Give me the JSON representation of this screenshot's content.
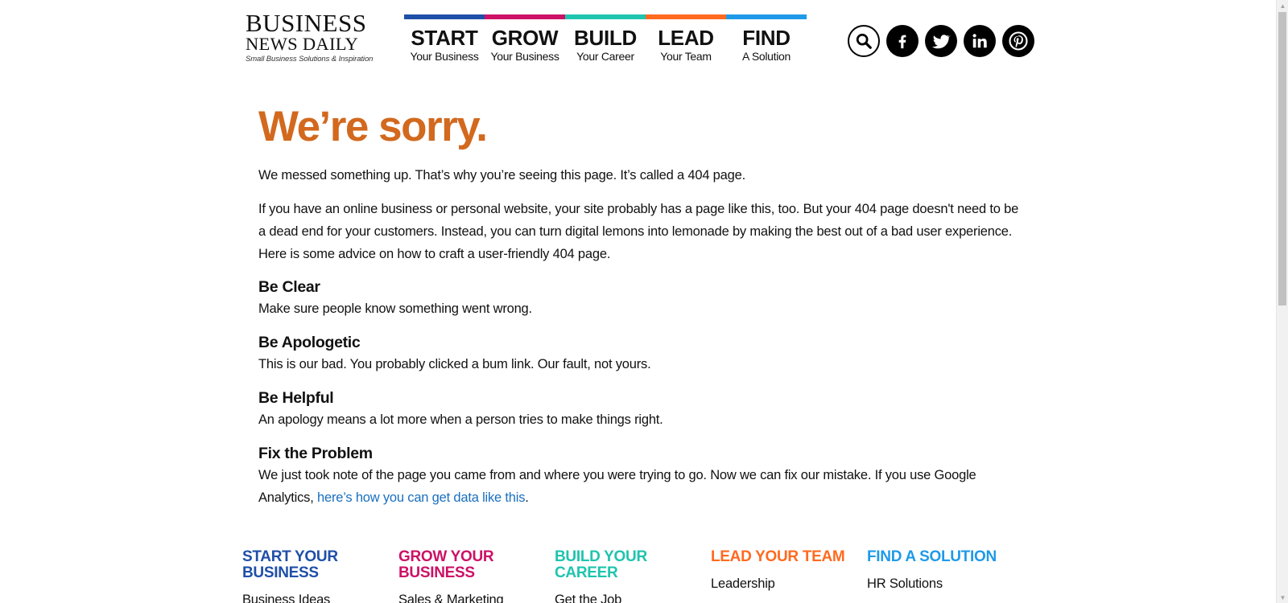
{
  "logo": {
    "line1": "BUSINESS",
    "line2": "NEWS DAILY",
    "tagline": "Small Business Solutions & Inspiration"
  },
  "nav": [
    {
      "title": "START",
      "sub": "Your Business",
      "color": "#1f4fa8"
    },
    {
      "title": "GROW",
      "sub": "Your Business",
      "color": "#cc1166"
    },
    {
      "title": "BUILD",
      "sub": "Your Career",
      "color": "#1fc4ae"
    },
    {
      "title": "LEAD",
      "sub": "Your Team",
      "color": "#ff6a1f"
    },
    {
      "title": "FIND",
      "sub": "A Solution",
      "color": "#1f9ae8"
    }
  ],
  "social": {
    "icons": [
      "search-icon",
      "facebook-icon",
      "twitter-icon",
      "linkedin-icon",
      "pinterest-icon"
    ]
  },
  "main": {
    "headline": "We’re sorry.",
    "intro": "We messed something up. That’s why you’re seeing this page. It’s called a 404 page.",
    "advice": "If you have an online business or personal website, your site probably has a page like this, too. But your 404 page doesn't need to be a dead end for your customers. Instead, you can turn digital lemons into lemonade by making the best out of a bad user experience. Here is some advice on how to craft a user-friendly 404 page.",
    "sections": [
      {
        "heading": "Be Clear",
        "text": "Make sure people know something went wrong."
      },
      {
        "heading": "Be Apologetic",
        "text": "This is our bad. You probably clicked a bum link. Our fault, not yours."
      },
      {
        "heading": "Be Helpful",
        "text": "An apology means a lot more when a person tries to make things right."
      }
    ],
    "fix": {
      "heading": "Fix the Problem",
      "text": "We just took note of the page you came from and where you were trying to go. Now we can fix our mistake. If you use Google Analytics, ",
      "link": "here’s how you can get data like this",
      "end": "."
    }
  },
  "footer": {
    "columns": [
      {
        "title": "START YOUR BUSINESS",
        "color": "#1f4fa8",
        "first_link": "Business Ideas"
      },
      {
        "title": "GROW YOUR BUSINESS",
        "color": "#cc1166",
        "first_link": "Sales & Marketing"
      },
      {
        "title": "BUILD YOUR CAREER",
        "color": "#1fc4ae",
        "first_link": "Get the Job"
      },
      {
        "title": "LEAD YOUR TEAM",
        "color": "#ff6a1f",
        "first_link": "Leadership"
      },
      {
        "title": "FIND A SOLUTION",
        "color": "#1f9ae8",
        "first_link": "HR Solutions"
      }
    ]
  },
  "colors": {
    "headline": "#d2691e",
    "link": "#1a6fbf"
  }
}
